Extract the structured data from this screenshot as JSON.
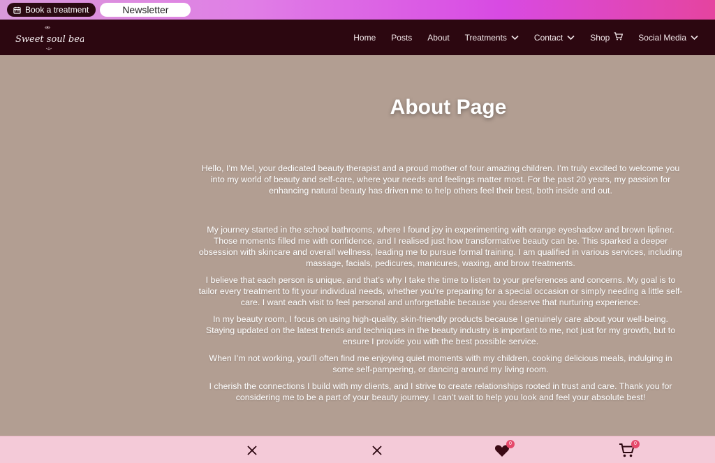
{
  "topbar": {
    "book_label": "Book a treatment",
    "newsletter_label": "Newsletter"
  },
  "logo": {
    "text": "Sweet soul beauty"
  },
  "nav": {
    "items": [
      {
        "label": "Home"
      },
      {
        "label": "Posts"
      },
      {
        "label": "About"
      },
      {
        "label": "Treatments"
      },
      {
        "label": "Contact"
      },
      {
        "label": "Shop"
      },
      {
        "label": "Social Media"
      }
    ]
  },
  "page": {
    "title": "About Page",
    "paragraphs": [
      "Hello, I’m Mel, your dedicated beauty therapist and a proud mother of four amazing children. I’m truly excited to welcome you into my world of beauty and self-care, where your needs and feelings matter most. For the past 20 years, my passion for enhancing natural beauty has driven me to help others feel their best, both inside and out.",
      "My journey started in the school bathrooms, where I found joy in experimenting with orange eyeshadow and brown lipliner. Those moments filled me with confidence, and I realised just how transformative beauty can be. This sparked a deeper obsession with skincare and overall wellness, leading me to pursue formal training. I am qualified in various services, including massage, facials, pedicures, manicures, waxing, and brow treatments.",
      "I believe that each person is unique, and that’s why I take the time to listen to your preferences and concerns. My goal is to tailor every treatment to fit your individual needs, whether you’re preparing for a special occasion or simply needing a little self-care. I want each visit to feel personal and unforgettable because you deserve that nurturing experience.",
      "In my beauty room, I focus on using high-quality, skin-friendly products because I genuinely care about your well-being. Staying updated on the latest trends and techniques in the beauty industry is important to me, not just for my growth, but to ensure I provide you with the best possible service.",
      "When I’m not working, you’ll often find me enjoying quiet moments with my children, cooking delicious meals, indulging in some self-pampering, or dancing around my living room.",
      "I cherish the connections I build with my clients, and I strive to create relationships rooted in trust and care. Thank you for considering me to be a part of your beauty journey. I can’t wait to help you look and feel your absolute best!"
    ]
  },
  "bottombar": {
    "wishlist_count": "0",
    "cart_count": "0"
  },
  "icons": [
    "calendar-icon",
    "chevron-down-icon",
    "cart-icon",
    "close-icon",
    "heart-icon"
  ],
  "colors": {
    "navbar_bg": "#2c0710",
    "page_bg": "#b29e92",
    "bottombar_bg": "#f4cad8",
    "badge": "#e5496b"
  }
}
